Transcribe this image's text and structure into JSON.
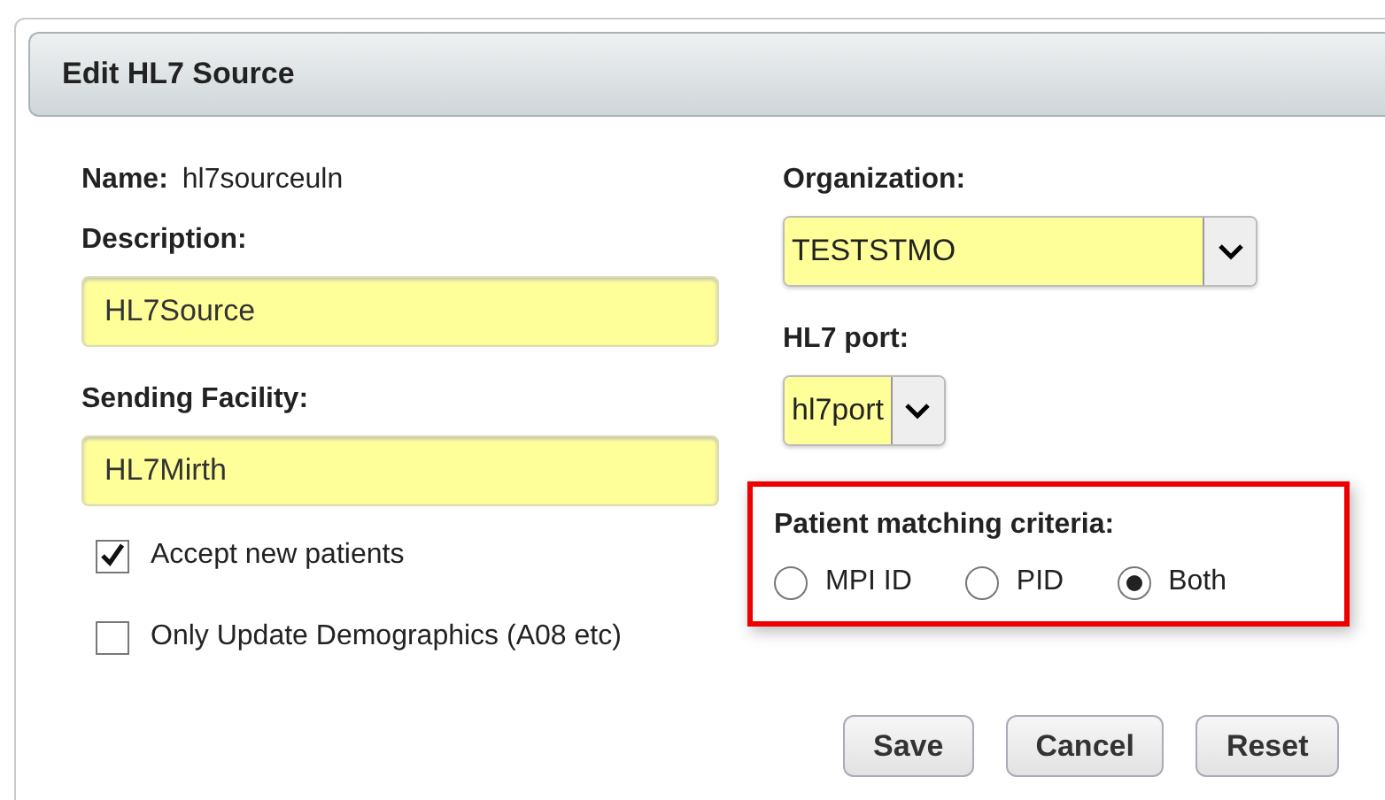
{
  "dialog": {
    "title": "Edit HL7 Source"
  },
  "name": {
    "label": "Name:",
    "value": "hl7sourceuln"
  },
  "description": {
    "label": "Description:",
    "value": "HL7Source"
  },
  "sending_facility": {
    "label": "Sending Facility:",
    "value": "HL7Mirth"
  },
  "checkboxes": [
    {
      "label": "Accept new patients",
      "checked": true
    },
    {
      "label": "Only Update Demographics (A08 etc)",
      "checked": false
    }
  ],
  "organization": {
    "label": "Organization:",
    "value": "TESTSTMO"
  },
  "hl7_port": {
    "label": "HL7 port:",
    "value": "hl7port"
  },
  "patient_matching": {
    "label": "Patient matching criteria:",
    "highlighted": true,
    "options": [
      {
        "label": "MPI ID",
        "selected": false
      },
      {
        "label": "PID",
        "selected": false
      },
      {
        "label": "Both",
        "selected": true
      }
    ]
  },
  "buttons": [
    "Save",
    "Cancel",
    "Reset"
  ]
}
